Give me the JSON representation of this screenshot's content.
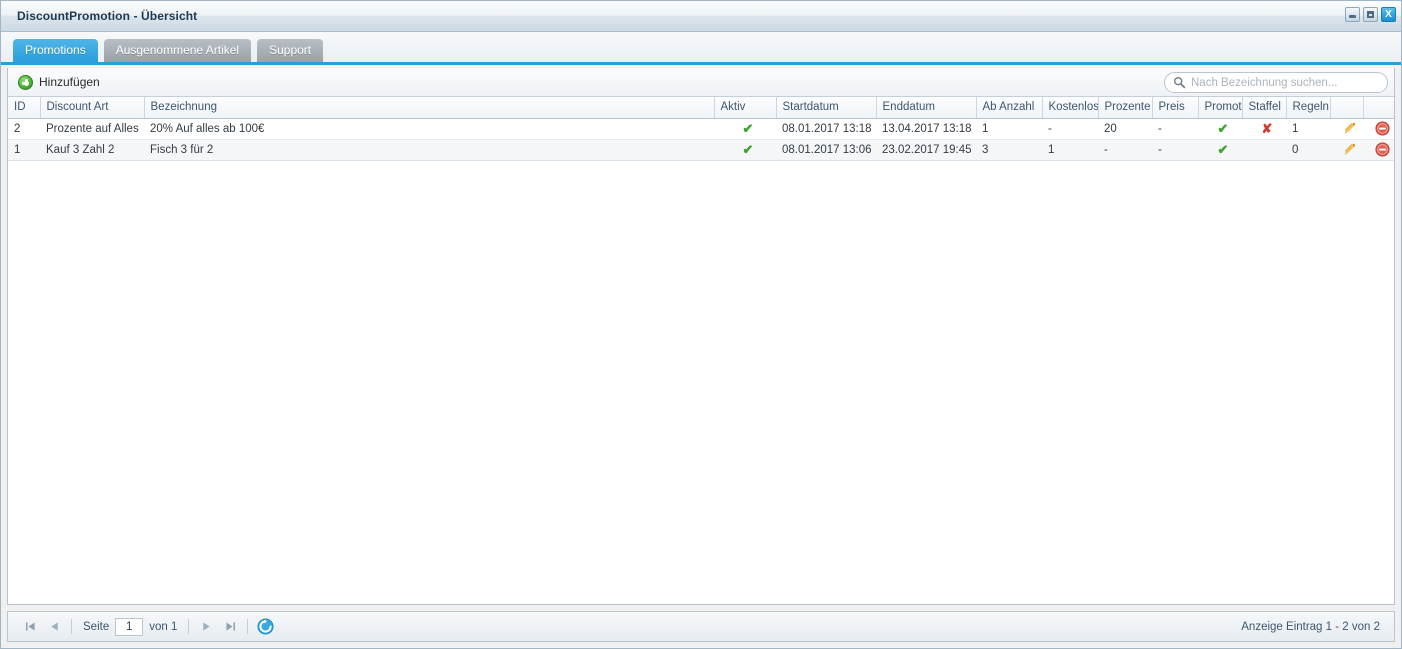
{
  "window": {
    "title": "DiscountPromotion - Übersicht",
    "buttons": {
      "minimize": "minimize",
      "maximize": "maximize",
      "close": "X"
    }
  },
  "tabs": [
    {
      "label": "Promotions",
      "active": true
    },
    {
      "label": "Ausgenommene Artikel",
      "active": false
    },
    {
      "label": "Support",
      "active": false
    }
  ],
  "toolbar": {
    "add_label": "Hinzufügen",
    "search_placeholder": "Nach Bezeichnung suchen...",
    "search_value": ""
  },
  "grid": {
    "columns": [
      "ID",
      "Discount Art",
      "Bezeichnung",
      "Aktiv",
      "Startdatum",
      "Enddatum",
      "Ab Anzahl",
      "Kostenlos",
      "Prozente",
      "Preis",
      "Promoti",
      "Staffel",
      "Regeln",
      "",
      ""
    ],
    "rows": [
      {
        "id": "2",
        "discount_art": "Prozente auf Alles",
        "bezeichnung": "20% Auf alles ab 100€",
        "aktiv": "check",
        "startdatum": "08.01.2017 13:18",
        "enddatum": "13.04.2017 13:18",
        "ab_anzahl": "1",
        "kostenlos": "-",
        "prozente": "20",
        "preis": "-",
        "promotion": "check",
        "staffel": "cross",
        "regeln": "1"
      },
      {
        "id": "1",
        "discount_art": "Kauf 3 Zahl 2",
        "bezeichnung": "Fisch 3 für 2",
        "aktiv": "check",
        "startdatum": "08.01.2017 13:06",
        "enddatum": "23.02.2017 19:45",
        "ab_anzahl": "3",
        "kostenlos": "1",
        "prozente": "-",
        "preis": "-",
        "promotion": "check",
        "staffel": "",
        "regeln": "0"
      }
    ],
    "check_glyph": "✔",
    "cross_glyph": "✘"
  },
  "footer": {
    "first_label": "first-page",
    "prev_label": "previous-page",
    "page_label": "Seite",
    "page_value": "1",
    "of_label": "von 1",
    "next_label": "next-page",
    "last_label": "last-page",
    "refresh_label": "refresh",
    "summary": "Anzeige Eintrag 1 - 2 von 2"
  },
  "colors": {
    "accent": "#2b9fdc",
    "ok": "#3ca32f",
    "error": "#d83a2c",
    "add": "#49b83a",
    "pencil": "#e8a33d",
    "remove": "#e06055"
  }
}
